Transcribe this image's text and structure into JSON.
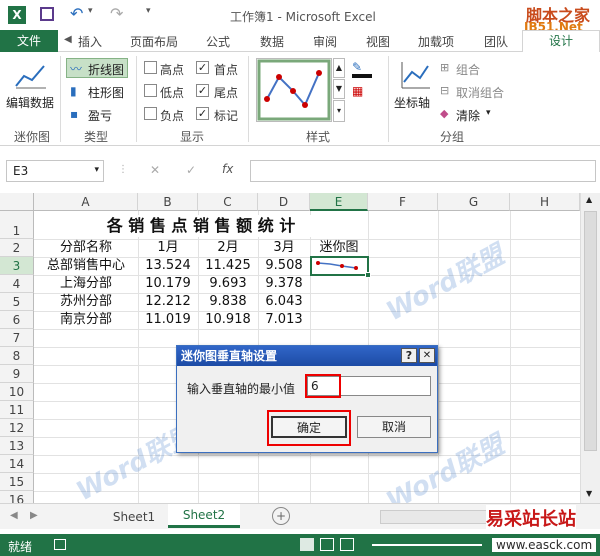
{
  "window": {
    "title": "工作簿1 - Microsoft Excel",
    "logo": "脚本之家",
    "logo_url": "JB51.Net"
  },
  "tabs": [
    "文件",
    "插入",
    "页面布局",
    "公式",
    "数据",
    "审阅",
    "视图",
    "加载项",
    "团队",
    "设计"
  ],
  "ribbon": {
    "edit_data": "编辑数据",
    "types": [
      "折线图",
      "柱形图",
      "盈亏"
    ],
    "show": [
      {
        "label": "高点",
        "checked": false
      },
      {
        "label": "首点",
        "checked": true
      },
      {
        "label": "低点",
        "checked": false
      },
      {
        "label": "尾点",
        "checked": true
      },
      {
        "label": "负点",
        "checked": false
      },
      {
        "label": "标记",
        "checked": true
      }
    ],
    "axis": "坐标轴",
    "group": "组合",
    "ungroup": "取消组合",
    "clear": "清除",
    "groups": [
      "迷你图",
      "类型",
      "显示",
      "样式",
      "分组"
    ]
  },
  "formula": {
    "name_box": "E3",
    "fx": "fx",
    "x": "✕",
    "check": "✓",
    "value": ""
  },
  "columns": [
    "A",
    "B",
    "C",
    "D",
    "E",
    "F",
    "G",
    "H"
  ],
  "rows": [
    "1",
    "2",
    "3",
    "4",
    "5",
    "6",
    "7",
    "8",
    "9",
    "10",
    "11",
    "12",
    "13",
    "14",
    "15",
    "16"
  ],
  "sheet": {
    "title": "各 销 售 点 销 售 额 统 计",
    "headers": [
      "分部名称",
      "1月",
      "2月",
      "3月",
      "迷你图"
    ],
    "data": [
      [
        "总部销售中心",
        "13.524",
        "11.425",
        "9.508"
      ],
      [
        "上海分部",
        "10.179",
        "9.693",
        "9.378"
      ],
      [
        "苏州分部",
        "12.212",
        "9.838",
        "6.043"
      ],
      [
        "南京分部",
        "11.019",
        "10.918",
        "7.013"
      ]
    ]
  },
  "dialog": {
    "title": "迷你图垂直轴设置",
    "help": "?",
    "close": "✕",
    "label": "输入垂直轴的最小值",
    "value": "6",
    "ok": "确定",
    "cancel": "取消"
  },
  "sheets": [
    "Sheet1",
    "Sheet2"
  ],
  "status": {
    "ready": "就绪"
  },
  "watermarks": [
    "Word联盟",
    "Word联盟",
    "Word联盟",
    "Word联盟"
  ],
  "corner_logo": "易采站长站",
  "corner_url": "www.easck.com"
}
